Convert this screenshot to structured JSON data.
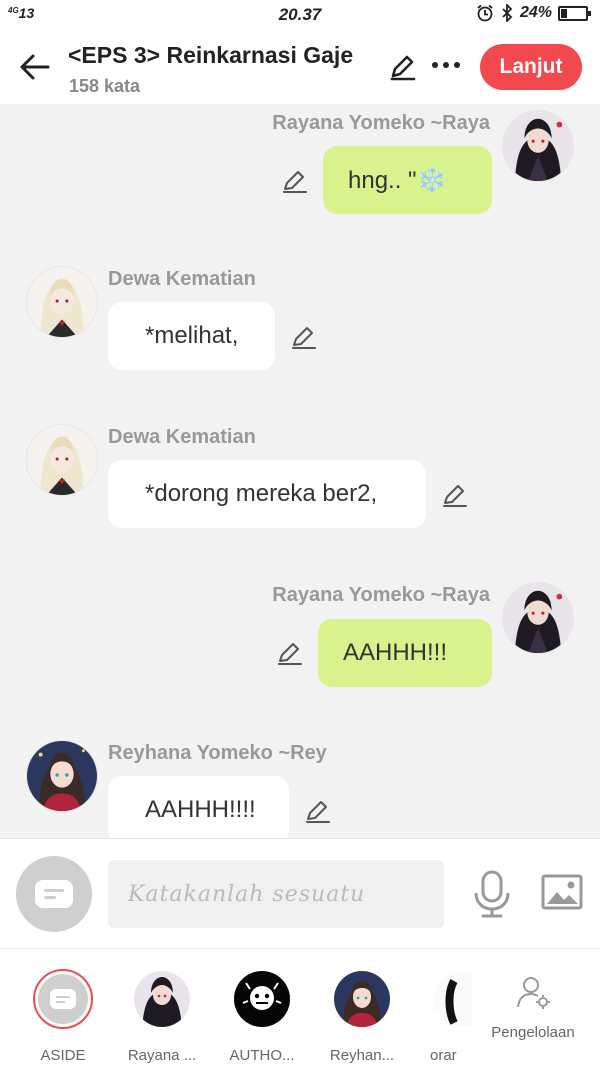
{
  "status": {
    "network": "4G",
    "signal": "13",
    "time": "20.37",
    "battery": "24%",
    "battery_level": 0.24
  },
  "header": {
    "title": "<EPS 3> Reinkarnasi Gaje",
    "subtitle": "158 kata",
    "next_label": "Lanjut"
  },
  "messages": [
    {
      "sender": "Rayana Yomeko ~Raya",
      "text": "hng.. \"❄️",
      "side": "right",
      "avatar": "dark-haired-girl"
    },
    {
      "sender": "Dewa Kematian",
      "text": "*melihat,",
      "side": "left",
      "avatar": "white-haired-man"
    },
    {
      "sender": "Dewa Kematian",
      "text": "*dorong mereka ber2,",
      "side": "left",
      "avatar": "white-haired-man"
    },
    {
      "sender": "Rayana Yomeko ~Raya",
      "text": "AAHHH!!!",
      "side": "right",
      "avatar": "dark-haired-girl"
    },
    {
      "sender": "Reyhana Yomeko ~Rey",
      "text": "AAHHH!!!!",
      "side": "left",
      "avatar": "red-dress-girl"
    }
  ],
  "composer": {
    "placeholder": "Katakanlah sesuatu"
  },
  "roles": [
    {
      "label": "ASIDE"
    },
    {
      "label": "Rayana ..."
    },
    {
      "label": "AUTHO..."
    },
    {
      "label": "Reyhan..."
    },
    {
      "label": "orar"
    }
  ],
  "manage_label": "Pengelolaan",
  "colors": {
    "accent": "#f2494e",
    "right_bubble": "#d8f28e"
  }
}
